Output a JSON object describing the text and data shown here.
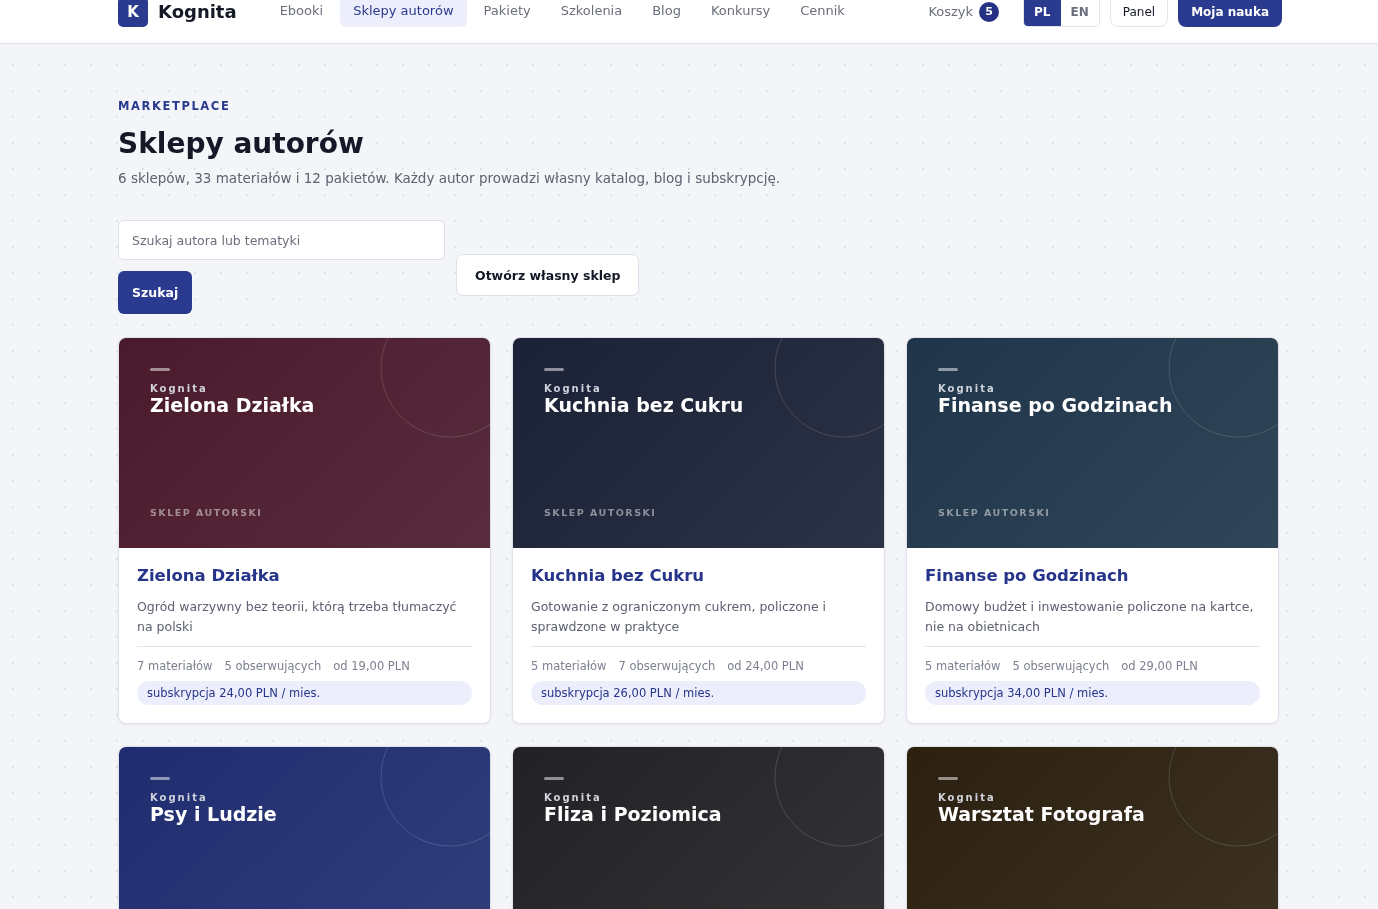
{
  "header": {
    "logo_letter": "K",
    "brand": "Kognita",
    "nav": [
      {
        "label": "Ebooki",
        "selected": false
      },
      {
        "label": "Sklepy autorów",
        "selected": true
      },
      {
        "label": "Pakiety",
        "selected": false
      },
      {
        "label": "Szkolenia",
        "selected": false
      },
      {
        "label": "Blog",
        "selected": false
      },
      {
        "label": "Konkursy",
        "selected": false
      },
      {
        "label": "Cennik",
        "selected": false
      }
    ],
    "cart": {
      "label": "Koszyk",
      "count": "5"
    },
    "languages": [
      {
        "label": "PL",
        "selected": true
      },
      {
        "label": "EN",
        "selected": false
      }
    ],
    "panel_button": "Panel",
    "primary_button": "Moja nauka"
  },
  "eyebrow": "MARKETPLACE",
  "title": "Sklepy autorów",
  "subtitle": "6 sklepów, 33 materiałów i 12 pakietów. Każdy autor prowadzi własny katalog, blog i subskrypcję.",
  "search": {
    "placeholder": "Szukaj autora lub tematyki",
    "button": "Szukaj"
  },
  "open_shop_button": "Otwórz własny sklep",
  "shops": [
    {
      "brand": "Kognita",
      "name": "Zielona Działka",
      "color": "#4a1a2c",
      "tag": "SKLEP AUTORSKI",
      "title": "Zielona Działka",
      "description": "Ogród warzywny bez teorii, którą trzeba tłumaczyć na polski",
      "materials": "7 materiałów",
      "followers": "5 obserwujących",
      "price": "od 19,00 PLN",
      "subscription": "subskrypcja 24,00 PLN / mies."
    },
    {
      "brand": "Kognita",
      "name": "Kuchnia bez Cukru",
      "color": "#1b2136",
      "tag": "SKLEP AUTORSKI",
      "title": "Kuchnia bez Cukru",
      "description": "Gotowanie z ograniczonym cukrem, policzone i sprawdzone w praktyce",
      "materials": "5 materiałów",
      "followers": "7 obserwujących",
      "price": "od 24,00 PLN",
      "subscription": "subskrypcja 26,00 PLN / mies."
    },
    {
      "brand": "Kognita",
      "name": "Finanse po Godzinach",
      "color": "#1f3549",
      "tag": "SKLEP AUTORSKI",
      "title": "Finanse po Godzinach",
      "description": "Domowy budżet i inwestowanie policzone na kartce, nie na obietnicach",
      "materials": "5 materiałów",
      "followers": "5 obserwujących",
      "price": "od 29,00 PLN",
      "subscription": "subskrypcja 34,00 PLN / mies."
    },
    {
      "brand": "Kognita",
      "name": "Psy i Ludzie",
      "color": "#1f2d70"
    },
    {
      "brand": "Kognita",
      "name": "Fliza i Poziomica",
      "color": "#222226"
    },
    {
      "brand": "Kognita",
      "name": "Warsztat Fotografa",
      "color": "#2c2010"
    }
  ]
}
